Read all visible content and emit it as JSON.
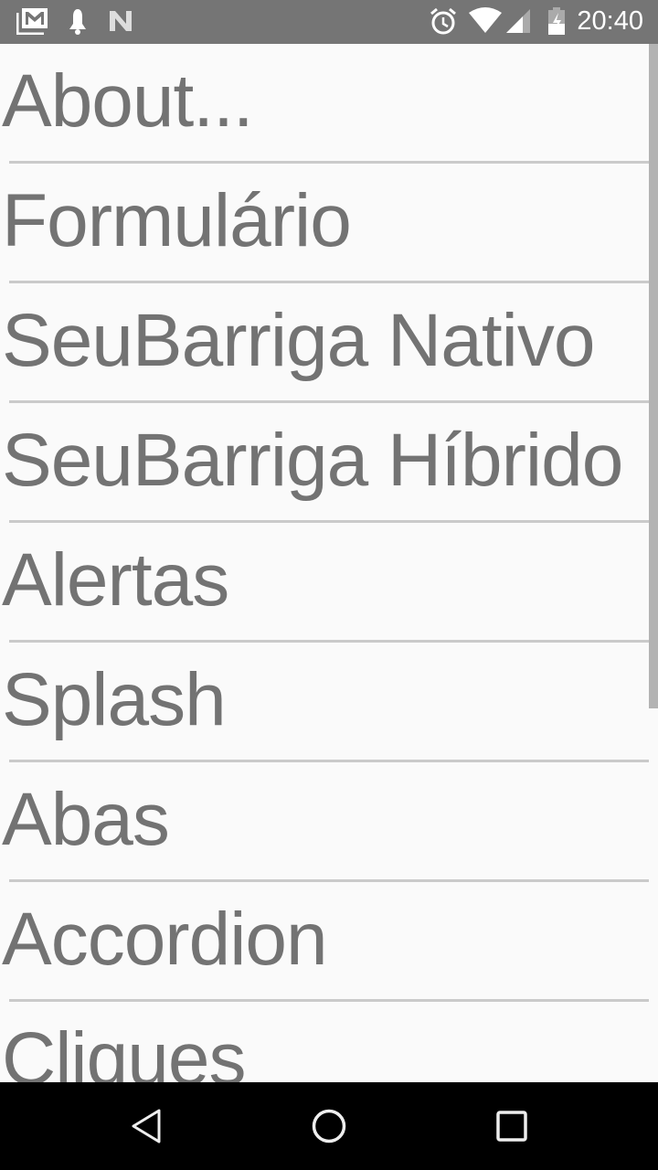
{
  "status_bar": {
    "time": "20:40",
    "left_icons": [
      "gmail-icon",
      "notification-bell-icon",
      "n-icon"
    ],
    "right_icons": [
      "alarm-icon",
      "wifi-icon",
      "signal-icon",
      "battery-charging-icon"
    ]
  },
  "menu": {
    "items": [
      {
        "label": "About..."
      },
      {
        "label": "Formulário"
      },
      {
        "label": "SeuBarriga Nativo"
      },
      {
        "label": "SeuBarriga Híbrido"
      },
      {
        "label": "Alertas"
      },
      {
        "label": "Splash"
      },
      {
        "label": "Abas"
      },
      {
        "label": "Accordion"
      },
      {
        "label": "Cliques"
      }
    ]
  },
  "nav_bar": {
    "buttons": [
      "back",
      "home",
      "recents"
    ]
  },
  "colors": {
    "text": "#737373",
    "divider": "#cacaca",
    "status_bar": "#757575",
    "background": "#fafafa"
  }
}
